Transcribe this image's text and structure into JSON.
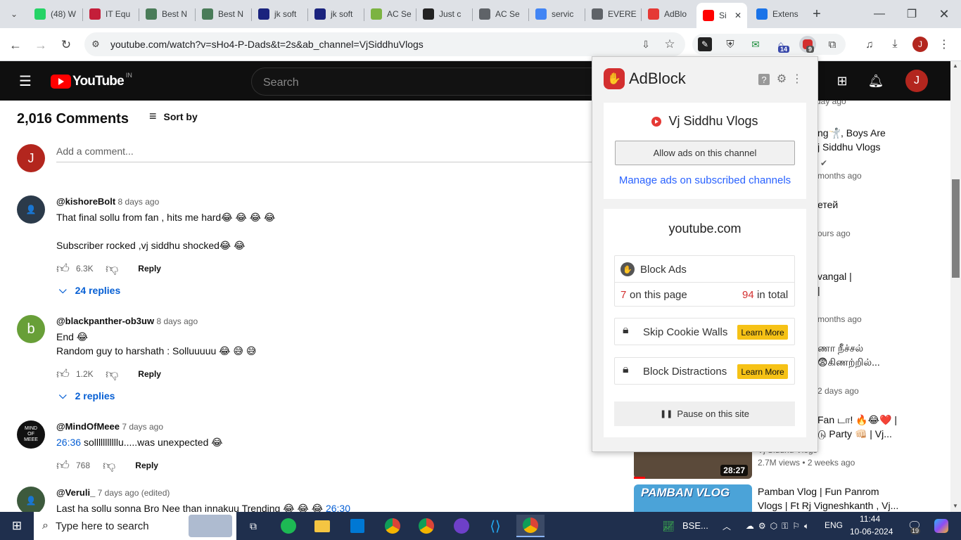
{
  "browser": {
    "tabs": [
      {
        "label": "(48) W",
        "color": "#25d366",
        "icon": "whatsapp-icon"
      },
      {
        "label": "IT Equ",
        "color": "#c41e3a",
        "icon": "vit-icon"
      },
      {
        "label": "Best N",
        "color": "#4a7c59",
        "icon": "doc-icon"
      },
      {
        "label": "Best N",
        "color": "#4a7c59",
        "icon": "doc-icon"
      },
      {
        "label": "jk soft",
        "color": "#1a237e",
        "icon": "jk-icon"
      },
      {
        "label": "jk soft",
        "color": "#1a237e",
        "icon": "jk-icon"
      },
      {
        "label": "AC Se",
        "color": "#7cb342",
        "icon": "pin-icon"
      },
      {
        "label": "Just c",
        "color": "#222222",
        "icon": "quora-icon"
      },
      {
        "label": "AC Se",
        "color": "#5f6368",
        "icon": "triangle-icon"
      },
      {
        "label": "servic",
        "color": "#4285f4",
        "icon": "google-icon"
      },
      {
        "label": "EVERE",
        "color": "#5f6368",
        "icon": "globe-icon"
      },
      {
        "label": "AdBlo",
        "color": "#e53935",
        "icon": "rainbow-icon"
      },
      {
        "label": "Si",
        "color": "#ff0000",
        "icon": "youtube-icon",
        "active": true
      },
      {
        "label": "Extens",
        "color": "#1a73e8",
        "icon": "puzzle-icon"
      }
    ],
    "url": "youtube.com/watch?v=sHo4-P-Dads&t=2s&ab_channel=VjSiddhuVlogs",
    "ext_badge_1": "14",
    "ext_badge_2": "9",
    "profile_initial": "J"
  },
  "youtube": {
    "logo_text": "YouTube",
    "region": "IN",
    "search_placeholder": "Search",
    "avatar_initial": "J"
  },
  "comments": {
    "count_label": "2,016 Comments",
    "sort_label": "Sort by",
    "add_placeholder": "Add a comment...",
    "user_initial": "J",
    "items": [
      {
        "author": "@kishoreBolt",
        "time": "8 days ago",
        "lines": [
          "That final sollu from fan , hits me hard😂 😂 😂 😂",
          "",
          "Subscriber rocked ,vj siddhu shocked😂 😂"
        ],
        "likes": "6.3K",
        "replies": "24 replies",
        "avatar_color": "#2b3a4a"
      },
      {
        "author": "@blackpanther-ob3uw",
        "time": "8 days ago",
        "lines": [
          "End 😂",
          "Random guy to harshath : Solluuuuu 😂 😅 😅"
        ],
        "likes": "1.2K",
        "replies": "2 replies",
        "avatar_letter": "b",
        "avatar_color": "#689f38"
      },
      {
        "author": "@MindOfMeee",
        "time": "7 days ago",
        "timestamp": "26:36",
        "lines": [
          "solllllllllllu.....was unexpected 😂"
        ],
        "likes": "768",
        "avatar_color": "#111111",
        "avatar_text": "MIND OF MEEE"
      },
      {
        "author": "@Veruli_",
        "time": "7 days ago (edited)",
        "lines": [
          "Last ha sollu sonna Bro Nee than innakuu Trending 😂 😂 😂"
        ],
        "timestamp": "26:30",
        "avatar_color": "#3d5a3d"
      }
    ],
    "reply_label": "Reply"
  },
  "sidebar": {
    "items": [
      {
        "title": [
          "",
          ""
        ],
        "meta": "day ago"
      },
      {
        "title": [
          "ng🤺, Boys Are",
          "j Siddhu Vlogs"
        ],
        "meta": "months ago"
      },
      {
        "title": [
          "етей",
          ""
        ],
        "meta": "ours ago"
      },
      {
        "title": [
          "vangal |",
          "|"
        ],
        "meta": "months ago"
      },
      {
        "title": [
          "ணா நீச்சல்",
          "😨கிணற்றில்..."
        ],
        "meta": "2 days ago"
      },
      {
        "title": [
          "Fan டா! 🔥😂❤️ |",
          "டு Party 👊🏻 | Vj..."
        ],
        "channel": "Vj Siddhu Vlogs",
        "meta": "2.7M views • 2 weeks ago",
        "duration": "28:27"
      },
      {
        "title": [
          "Pamban Vlog | Fun Panrom",
          "Vlogs | Ft Rj Vigneshkanth , Vj..."
        ],
        "thumb_text": "PAMBAN VLOG"
      }
    ]
  },
  "adblock": {
    "brand": "AdBlock",
    "channel_name": "Vj Siddhu Vlogs",
    "allow_button": "Allow ads on this channel",
    "manage_link": "Manage ads on subscribed channels",
    "domain": "youtube.com",
    "block_ads_label": "Block Ads",
    "page_count": "7",
    "page_count_label": "on this page",
    "total_count": "94",
    "total_label": "in total",
    "skip_cookie_label": "Skip Cookie Walls",
    "block_distractions_label": "Block Distractions",
    "learn_more": "Learn More",
    "pause_label": "Pause on this site",
    "accent": "#d32f2f",
    "learn_color": "#f6c216"
  },
  "taskbar": {
    "search_placeholder": "Type here to search",
    "stock_label": "BSE...",
    "language": "ENG",
    "time": "11:44",
    "date": "10-06-2024",
    "notif_count": "19"
  }
}
